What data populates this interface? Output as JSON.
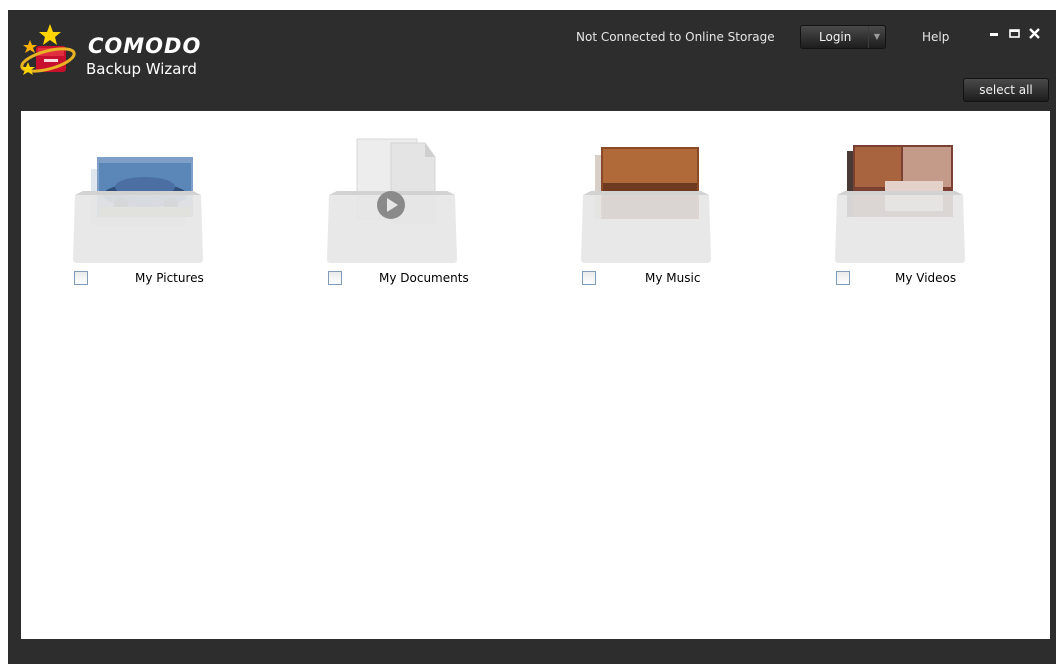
{
  "app": {
    "brand_name": "COMODO",
    "brand_sub": "Backup Wizard"
  },
  "header": {
    "status_text": "Not Connected to Online Storage",
    "login_label": "Login",
    "help_label": "Help",
    "select_all_label": "select all"
  },
  "folders": [
    {
      "label": "My Pictures",
      "icon": "pictures-folder-icon",
      "checked": false
    },
    {
      "label": "My Documents",
      "icon": "documents-folder-icon",
      "checked": false
    },
    {
      "label": "My Music",
      "icon": "music-folder-icon",
      "checked": false
    },
    {
      "label": "My Videos",
      "icon": "videos-folder-icon",
      "checked": false
    }
  ],
  "colors": {
    "frame": "#2d2d2d",
    "content_bg": "#ffffff",
    "button_gradient_top": "#4a4a4a",
    "button_gradient_bottom": "#1d1d1d"
  }
}
